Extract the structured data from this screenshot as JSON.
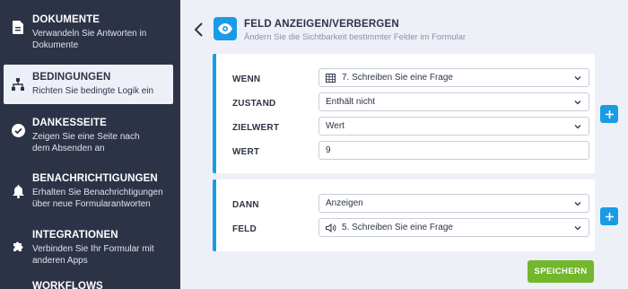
{
  "sidebar": {
    "items": [
      {
        "title": "DOKUMENTE",
        "desc": "Verwandeln Sie Antworten in Dokumente",
        "icon": "document-icon"
      },
      {
        "title": "BEDINGUNGEN",
        "desc": "Richten Sie bedingte Logik ein",
        "icon": "flow-icon",
        "active": true
      },
      {
        "title": "DANKESSEITE",
        "desc": "Zeigen Sie eine Seite nach dem Absenden an",
        "icon": "check-circle-icon"
      },
      {
        "title": "BENACHRICHTIGUNGEN",
        "desc": "Erhalten Sie Benachrichtigungen über neue Formularantworten",
        "icon": "bell-icon"
      },
      {
        "title": "INTEGRATIONEN",
        "desc": "Verbinden Sie Ihr Formular mit anderen Apps",
        "icon": "puzzle-icon"
      },
      {
        "title": "WORKFLOWS",
        "desc": "",
        "icon": "workflow-icon"
      }
    ]
  },
  "header": {
    "title": "FELD ANZEIGEN/VERBERGEN",
    "subtitle": "Ändern Sie die Sichtbarkeit bestimmter Felder im Formular",
    "icon": "eye-icon"
  },
  "condition": {
    "wenn_label": "WENN",
    "wenn_value": "7. Schreiben Sie eine Frage",
    "zustand_label": "ZUSTAND",
    "zustand_value": "Enthält nicht",
    "zielwert_label": "ZIELWERT",
    "zielwert_value": "Wert",
    "wert_label": "WERT",
    "wert_value": "9"
  },
  "action": {
    "dann_label": "DANN",
    "dann_value": "Anzeigen",
    "feld_label": "FELD",
    "feld_value": "5. Schreiben Sie eine Frage"
  },
  "buttons": {
    "save_label": "SPEICHERN"
  },
  "colors": {
    "accent": "#1a9be6",
    "save": "#73b72d",
    "sidebar_bg": "#2d3347"
  }
}
